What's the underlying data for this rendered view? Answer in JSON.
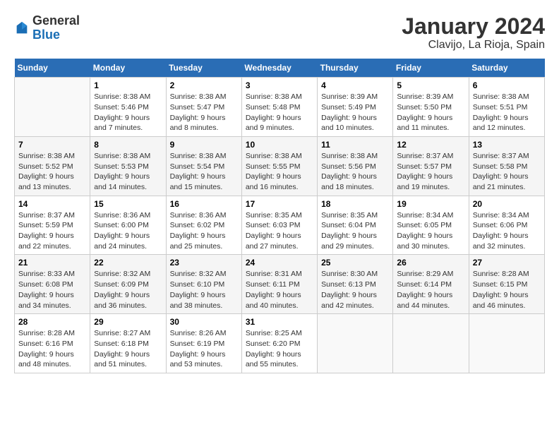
{
  "header": {
    "logo_general": "General",
    "logo_blue": "Blue",
    "title": "January 2024",
    "subtitle": "Clavijo, La Rioja, Spain"
  },
  "calendar": {
    "days_of_week": [
      "Sunday",
      "Monday",
      "Tuesday",
      "Wednesday",
      "Thursday",
      "Friday",
      "Saturday"
    ],
    "weeks": [
      [
        {
          "day": "",
          "detail": ""
        },
        {
          "day": "1",
          "detail": "Sunrise: 8:38 AM\nSunset: 5:46 PM\nDaylight: 9 hours\nand 7 minutes."
        },
        {
          "day": "2",
          "detail": "Sunrise: 8:38 AM\nSunset: 5:47 PM\nDaylight: 9 hours\nand 8 minutes."
        },
        {
          "day": "3",
          "detail": "Sunrise: 8:38 AM\nSunset: 5:48 PM\nDaylight: 9 hours\nand 9 minutes."
        },
        {
          "day": "4",
          "detail": "Sunrise: 8:39 AM\nSunset: 5:49 PM\nDaylight: 9 hours\nand 10 minutes."
        },
        {
          "day": "5",
          "detail": "Sunrise: 8:39 AM\nSunset: 5:50 PM\nDaylight: 9 hours\nand 11 minutes."
        },
        {
          "day": "6",
          "detail": "Sunrise: 8:38 AM\nSunset: 5:51 PM\nDaylight: 9 hours\nand 12 minutes."
        }
      ],
      [
        {
          "day": "7",
          "detail": "Sunrise: 8:38 AM\nSunset: 5:52 PM\nDaylight: 9 hours\nand 13 minutes."
        },
        {
          "day": "8",
          "detail": "Sunrise: 8:38 AM\nSunset: 5:53 PM\nDaylight: 9 hours\nand 14 minutes."
        },
        {
          "day": "9",
          "detail": "Sunrise: 8:38 AM\nSunset: 5:54 PM\nDaylight: 9 hours\nand 15 minutes."
        },
        {
          "day": "10",
          "detail": "Sunrise: 8:38 AM\nSunset: 5:55 PM\nDaylight: 9 hours\nand 16 minutes."
        },
        {
          "day": "11",
          "detail": "Sunrise: 8:38 AM\nSunset: 5:56 PM\nDaylight: 9 hours\nand 18 minutes."
        },
        {
          "day": "12",
          "detail": "Sunrise: 8:37 AM\nSunset: 5:57 PM\nDaylight: 9 hours\nand 19 minutes."
        },
        {
          "day": "13",
          "detail": "Sunrise: 8:37 AM\nSunset: 5:58 PM\nDaylight: 9 hours\nand 21 minutes."
        }
      ],
      [
        {
          "day": "14",
          "detail": "Sunrise: 8:37 AM\nSunset: 5:59 PM\nDaylight: 9 hours\nand 22 minutes."
        },
        {
          "day": "15",
          "detail": "Sunrise: 8:36 AM\nSunset: 6:00 PM\nDaylight: 9 hours\nand 24 minutes."
        },
        {
          "day": "16",
          "detail": "Sunrise: 8:36 AM\nSunset: 6:02 PM\nDaylight: 9 hours\nand 25 minutes."
        },
        {
          "day": "17",
          "detail": "Sunrise: 8:35 AM\nSunset: 6:03 PM\nDaylight: 9 hours\nand 27 minutes."
        },
        {
          "day": "18",
          "detail": "Sunrise: 8:35 AM\nSunset: 6:04 PM\nDaylight: 9 hours\nand 29 minutes."
        },
        {
          "day": "19",
          "detail": "Sunrise: 8:34 AM\nSunset: 6:05 PM\nDaylight: 9 hours\nand 30 minutes."
        },
        {
          "day": "20",
          "detail": "Sunrise: 8:34 AM\nSunset: 6:06 PM\nDaylight: 9 hours\nand 32 minutes."
        }
      ],
      [
        {
          "day": "21",
          "detail": "Sunrise: 8:33 AM\nSunset: 6:08 PM\nDaylight: 9 hours\nand 34 minutes."
        },
        {
          "day": "22",
          "detail": "Sunrise: 8:32 AM\nSunset: 6:09 PM\nDaylight: 9 hours\nand 36 minutes."
        },
        {
          "day": "23",
          "detail": "Sunrise: 8:32 AM\nSunset: 6:10 PM\nDaylight: 9 hours\nand 38 minutes."
        },
        {
          "day": "24",
          "detail": "Sunrise: 8:31 AM\nSunset: 6:11 PM\nDaylight: 9 hours\nand 40 minutes."
        },
        {
          "day": "25",
          "detail": "Sunrise: 8:30 AM\nSunset: 6:13 PM\nDaylight: 9 hours\nand 42 minutes."
        },
        {
          "day": "26",
          "detail": "Sunrise: 8:29 AM\nSunset: 6:14 PM\nDaylight: 9 hours\nand 44 minutes."
        },
        {
          "day": "27",
          "detail": "Sunrise: 8:28 AM\nSunset: 6:15 PM\nDaylight: 9 hours\nand 46 minutes."
        }
      ],
      [
        {
          "day": "28",
          "detail": "Sunrise: 8:28 AM\nSunset: 6:16 PM\nDaylight: 9 hours\nand 48 minutes."
        },
        {
          "day": "29",
          "detail": "Sunrise: 8:27 AM\nSunset: 6:18 PM\nDaylight: 9 hours\nand 51 minutes."
        },
        {
          "day": "30",
          "detail": "Sunrise: 8:26 AM\nSunset: 6:19 PM\nDaylight: 9 hours\nand 53 minutes."
        },
        {
          "day": "31",
          "detail": "Sunrise: 8:25 AM\nSunset: 6:20 PM\nDaylight: 9 hours\nand 55 minutes."
        },
        {
          "day": "",
          "detail": ""
        },
        {
          "day": "",
          "detail": ""
        },
        {
          "day": "",
          "detail": ""
        }
      ]
    ]
  }
}
